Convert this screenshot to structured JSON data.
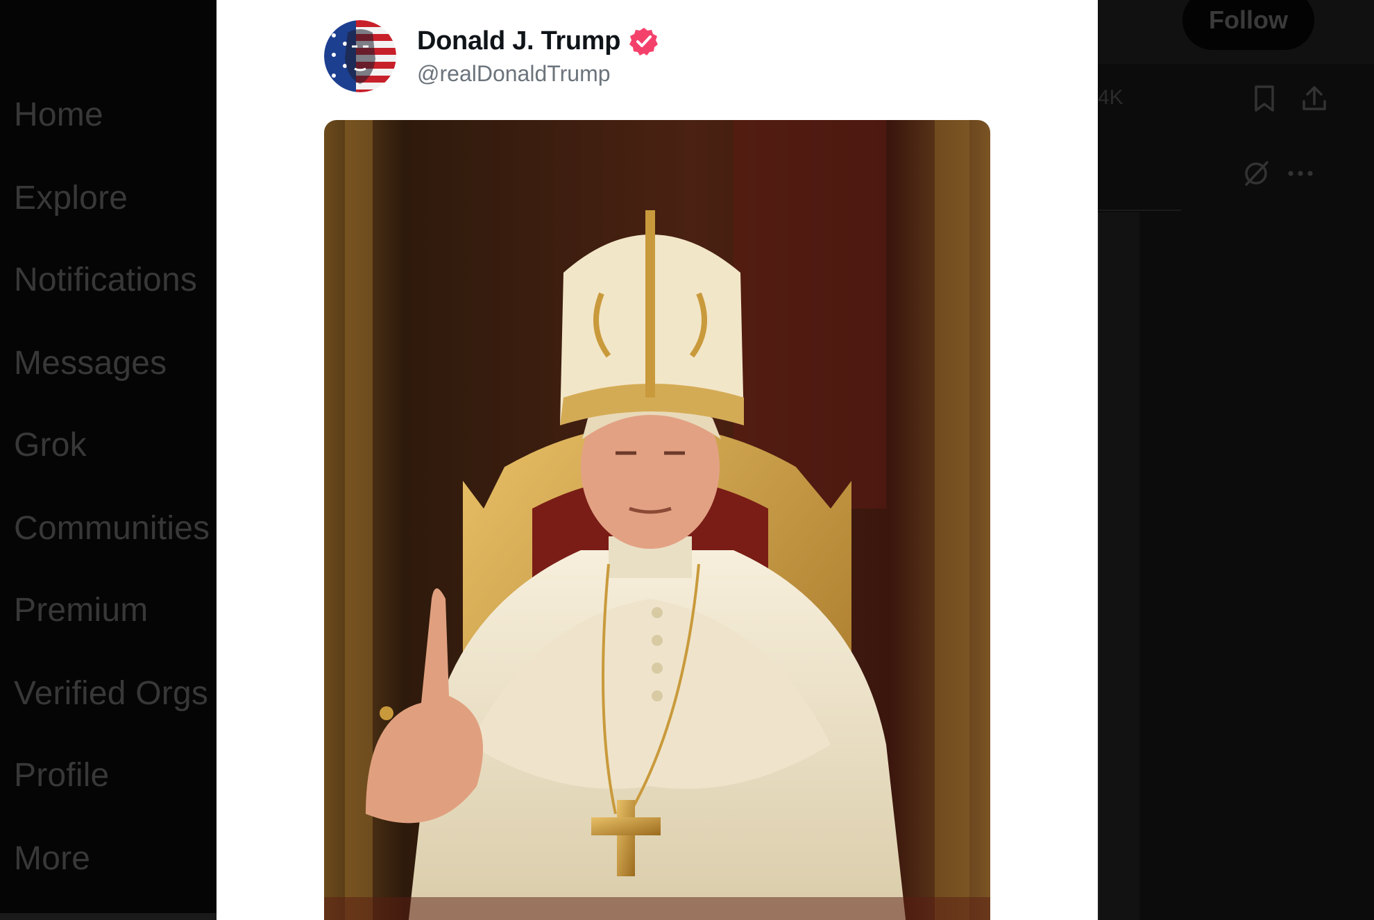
{
  "sidebar": {
    "items": [
      {
        "label": "Home"
      },
      {
        "label": "Explore"
      },
      {
        "label": "Notifications"
      },
      {
        "label": "Messages"
      },
      {
        "label": "Grok"
      },
      {
        "label": "Communities"
      },
      {
        "label": "Premium"
      },
      {
        "label": "Verified Orgs"
      },
      {
        "label": "Profile"
      },
      {
        "label": "More"
      }
    ]
  },
  "post": {
    "author": {
      "display_name": "Donald J. Trump",
      "handle": "@realDonaldTrump",
      "verified": true,
      "avatar_icon": "american-flag-face-avatar"
    },
    "media_icon": "photo-of-man-dressed-as-pope-on-golden-throne"
  },
  "right": {
    "follow_label": "Follow",
    "count_text": "4K",
    "icons": [
      "bookmark-icon",
      "share-icon",
      "grok-icon",
      "more-icon"
    ]
  },
  "colors": {
    "verified_badge": "#f4416c",
    "modal_background": "#ffffff",
    "overlay_background": "#0a0a0a"
  }
}
